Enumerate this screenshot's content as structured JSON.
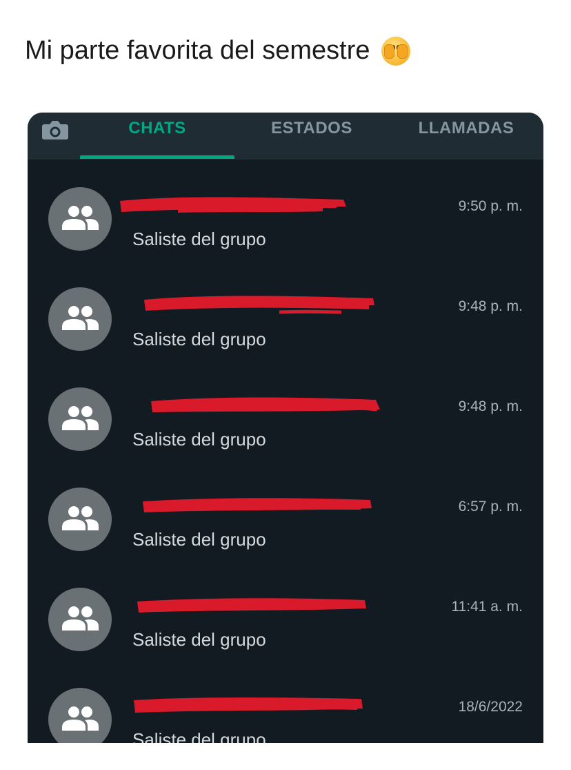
{
  "post": {
    "title": "Mi parte favorita del semestre",
    "emoji": "face-with-hand-over-mouth-emoji"
  },
  "app": {
    "camera_icon": "camera-icon",
    "tabs": [
      {
        "label": "CHATS",
        "active": true
      },
      {
        "label": "ESTADOS",
        "active": false
      },
      {
        "label": "LLAMADAS",
        "active": false
      }
    ],
    "accent_color": "#00a884",
    "background_color": "#111b21",
    "header_color": "#1f2c34",
    "redaction_color": "#d91a2a"
  },
  "chats": [
    {
      "name": "[redacted]",
      "message": "Saliste del grupo",
      "time": "9:50 p. m.",
      "avatar_icon": "group-icon"
    },
    {
      "name": "[redacted]",
      "message": "Saliste del grupo",
      "time": "9:48 p. m.",
      "avatar_icon": "group-icon"
    },
    {
      "name": "[redacted]",
      "message": "Saliste del grupo",
      "time": "9:48 p. m.",
      "avatar_icon": "group-icon"
    },
    {
      "name": "[redacted]",
      "message": "Saliste del grupo",
      "time": "6:57 p. m.",
      "avatar_icon": "group-icon"
    },
    {
      "name": "[redacted]",
      "message": "Saliste del grupo",
      "time": "11:41 a. m.",
      "avatar_icon": "group-icon"
    },
    {
      "name": "[redacted]",
      "message": "Saliste del grupo",
      "time": "18/6/2022",
      "avatar_icon": "group-icon"
    }
  ]
}
